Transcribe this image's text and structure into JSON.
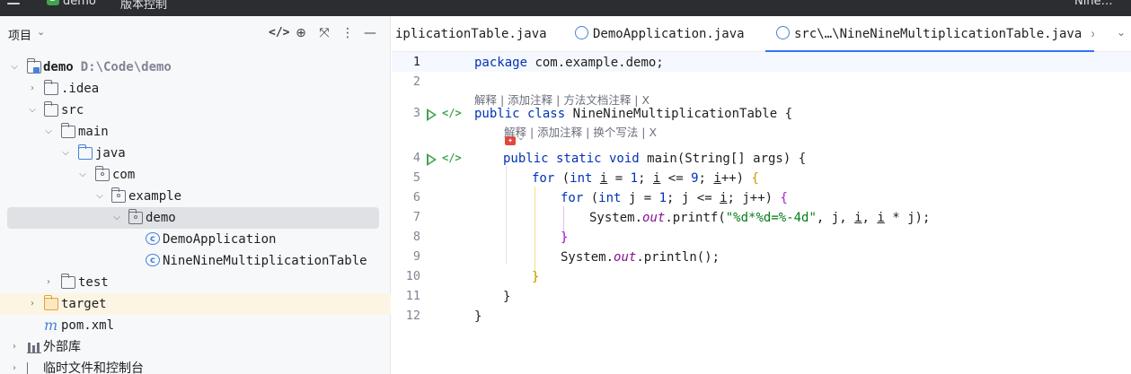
{
  "topbar": {
    "project_badge": "D",
    "project_name": "demo",
    "vcs_label": "版本控制",
    "right_label": "Nine…"
  },
  "project_panel": {
    "title": "项目",
    "tree": [
      {
        "label": "demo",
        "path": "D:\\Code\\demo"
      },
      {
        "label": ".idea"
      },
      {
        "label": "src"
      },
      {
        "label": "main"
      },
      {
        "label": "java"
      },
      {
        "label": "com"
      },
      {
        "label": "example"
      },
      {
        "label": "demo"
      },
      {
        "label": "DemoApplication"
      },
      {
        "label": "NineNineMultiplicationTable"
      },
      {
        "label": "test"
      },
      {
        "label": "target"
      },
      {
        "label": "pom.xml"
      },
      {
        "label": "外部库"
      },
      {
        "label": "临时文件和控制台"
      }
    ]
  },
  "editor": {
    "tabs": [
      {
        "label": "iplicationTable.java"
      },
      {
        "label": "DemoApplication.java"
      },
      {
        "label": "src\\…\\NineNineMultiplicationTable.java"
      }
    ],
    "line_numbers": [
      "1",
      "2",
      "3",
      "4",
      "5",
      "6",
      "7",
      "8",
      "9",
      "10",
      "11",
      "12"
    ],
    "hints": {
      "class_hint": "解释 | 添加注释 | 方法文档注释 | X",
      "method_hint": "解释 | 添加注释 | 换个写法 | X"
    },
    "code": {
      "l1_kw": "package",
      "l1_rest": " com.example.demo;",
      "l3_kw": "public class",
      "l3_rest": " NineNineMultiplicationTable ",
      "l3_brace": "{",
      "l4_kw": "public static void",
      "l4_rest": " main(String[] args) ",
      "l4_brace": "{",
      "l5_kw": "for",
      "l5_open": " (",
      "l5_int": "int",
      "l5_var": "i",
      "l5_mid": " = ",
      "l5_n1": "1",
      "l5_semi1": "; ",
      "l5_var2": "i",
      "l5_cmp": " <= ",
      "l5_n2": "9",
      "l5_semi2": "; ",
      "l5_var3": "i",
      "l5_inc": "++",
      "l5_close": ") ",
      "l5_brace": "{",
      "l6_kw": "for",
      "l6_open": " (",
      "l6_int": "int",
      "l6_a": " j = ",
      "l6_n1": "1",
      "l6_b": "; j <= ",
      "l6_var": "i",
      "l6_c": "; j++) ",
      "l6_brace": "{",
      "l7_a": "System.",
      "l7_out": "out",
      "l7_b": ".printf(",
      "l7_str": "\"%d*%d=%-4d\"",
      "l7_c": ", j, ",
      "l7_i1": "i",
      "l7_d": ", ",
      "l7_i2": "i",
      "l7_e": " * j);",
      "l8_brace": "}",
      "l9_a": "System.",
      "l9_out": "out",
      "l9_b": ".println();",
      "l10_brace": "}",
      "l11_brace": "}",
      "l12_brace": "}"
    }
  }
}
